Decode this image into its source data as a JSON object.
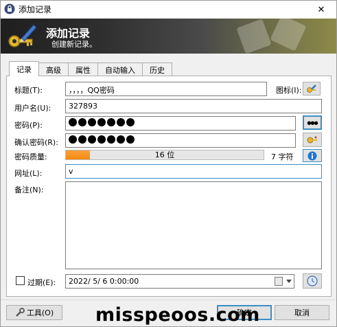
{
  "window": {
    "title": "添加记录",
    "close_glyph": "✕"
  },
  "banner": {
    "title": "添加记录",
    "subtitle": "创建新记录。"
  },
  "tabs": [
    {
      "label": "记录",
      "active": true
    },
    {
      "label": "高级"
    },
    {
      "label": "属性"
    },
    {
      "label": "自动输入"
    },
    {
      "label": "历史"
    }
  ],
  "form": {
    "title_label": "标题(T):",
    "title_value": "，，，，QQ密码",
    "icon_label": "图标(I):",
    "username_label": "用户名(U):",
    "username_value": "327893",
    "password_label": "密码(P):",
    "password_dot_count": 7,
    "confirm_label": "确认密码(R):",
    "quality_label": "密码质量:",
    "quality_text": "16 位",
    "quality_percent": 12,
    "char_count": "7 字符",
    "url_label": "网址(L):",
    "url_value": "v",
    "notes_label": "备注(N):",
    "notes_value": "",
    "expires_label": "过期(E):",
    "expires_checked": false,
    "expires_value": "2022/ 5/ 6  0:00:00",
    "reveal_glyph": "●●●"
  },
  "footer": {
    "tools_label": "工具(O)",
    "ok_label": "确定",
    "cancel_label": "取消",
    "watermark": "misspeoos.com"
  },
  "colors": {
    "accent": "#3c8ec4",
    "quality_fill": "#f58a0c",
    "info_blue": "#1e78d2"
  }
}
